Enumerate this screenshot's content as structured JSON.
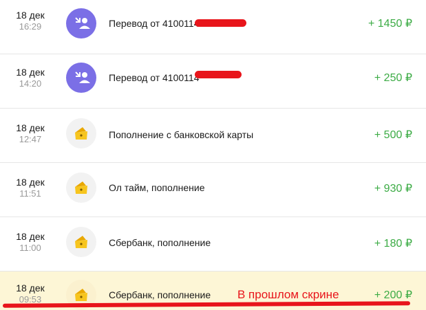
{
  "transactions": [
    {
      "day": "18 дек",
      "time": "16:29",
      "icon": "incoming-transfer-icon",
      "description": "Перевод от 4100114",
      "amount": "+ 1450 ₽"
    },
    {
      "day": "18 дек",
      "time": "14:20",
      "icon": "incoming-transfer-icon",
      "description": "Перевод от 4100114",
      "amount": "+ 250 ₽"
    },
    {
      "day": "18 дек",
      "time": "12:47",
      "icon": "wallet-icon",
      "description": "Пополнение с банковской карты",
      "amount": "+ 500 ₽"
    },
    {
      "day": "18 дек",
      "time": "11:51",
      "icon": "wallet-icon",
      "description": "Ол тайм, пополнение",
      "amount": "+ 930 ₽"
    },
    {
      "day": "18 дек",
      "time": "11:00",
      "icon": "wallet-icon",
      "description": "Сбербанк, пополнение",
      "amount": "+ 180 ₽"
    },
    {
      "day": "18 дек",
      "time": "09:53",
      "icon": "wallet-icon",
      "description": "Сбербанк, пополнение",
      "amount": "+ 200 ₽"
    }
  ],
  "annotation": {
    "text": "В прошлом скрине"
  },
  "colors": {
    "amount": "#3bab44",
    "transfer_icon_bg": "#7b6fe6",
    "wallet_yellow": "#f7c51e",
    "annotation_red": "#e8151b",
    "highlight_bg": "#fdf6d6"
  }
}
